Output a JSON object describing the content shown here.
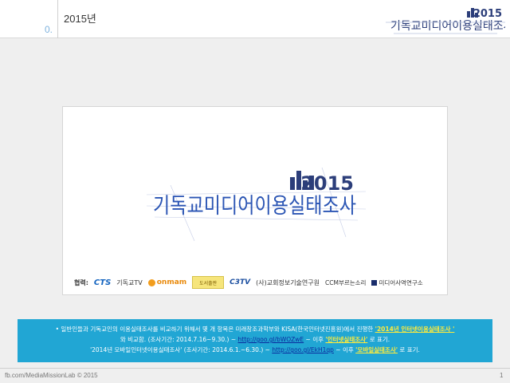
{
  "header": {
    "section_number": "0.",
    "title": "2015년",
    "logo_text": "기독교미디어이용실태조사",
    "logo_year": "2015"
  },
  "card": {
    "logo_text": "기독교미디어이용실태조사",
    "logo_year": "2015",
    "partners_label": "협력:",
    "partners": {
      "cts": "CTS",
      "cts_tv": "기독교TV",
      "onmam": "onmam",
      "book": "도서출판",
      "c3tv": "C3TV",
      "kcri": "(사)교회정보기술연구원",
      "ccm": "CCM부르는소리",
      "media": "미디어사역연구소"
    }
  },
  "notice": {
    "line1_pre": "• 일반인들과 기독교인의 이용실태조사를 비교하기 위해서 몇 개 항목은 미래창조과학부와 KISA(한국인터넷진흥원)에서 진행한 ",
    "line1_hl": "'2014년 인터넷이용실태조사 '",
    "line2_pre": "와 비교함. (조사기간: 2014.7.16~9.30.) ~ ",
    "line2_link": "http://goo.gl/bWOZwE",
    "line2_mid": " ~ 이후 ",
    "line2_hl": "'인터넷실태조사'",
    "line2_post": " 로 표기.",
    "line3_pre": "'2014년 모바일인터넷이용실태조사' (조사기간: 2014.6.1.~6.30.) ~ ",
    "line3_link": "http://goo.gl/EkH1qp",
    "line3_mid": " ~ 이후 ",
    "line3_hl": "'모바일실태조사'",
    "line3_post": " 로 표기."
  },
  "footer": {
    "left": "fb.com/MediaMissionLab © 2015",
    "page": "1"
  },
  "colors": {
    "notice_bg": "#21a6d4",
    "accent_blue": "#1a2e6c",
    "logo_blue": "#2b55b4",
    "highlight_yellow": "#ffeb3b"
  }
}
